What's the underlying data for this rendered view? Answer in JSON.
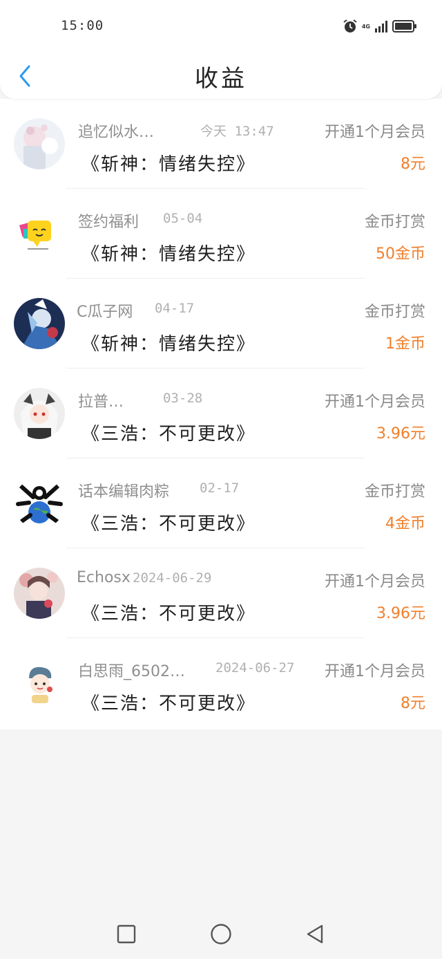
{
  "status_bar": {
    "time": "15:00",
    "network": "4G"
  },
  "header": {
    "title": "收益"
  },
  "items": [
    {
      "name": "追忆似水…",
      "time": "今天 13:47",
      "type": "开通1个月会员",
      "book": "《斩神：情绪失控》",
      "amount": "8元"
    },
    {
      "name": "签约福利",
      "time": "05-04",
      "type": "金币打赏",
      "book": "《斩神：情绪失控》",
      "amount": "50金币"
    },
    {
      "name": "C瓜子网",
      "time": "04-17",
      "type": "金币打赏",
      "book": "《斩神：情绪失控》",
      "amount": "1金币"
    },
    {
      "name": "拉普…",
      "time": "03-28",
      "type": "开通1个月会员",
      "book": "《三浩：不可更改》",
      "amount": "3.96元"
    },
    {
      "name": "话本编辑肉粽",
      "time": "02-17",
      "type": "金币打赏",
      "book": "《三浩：不可更改》",
      "amount": "4金币"
    },
    {
      "name": "Echosx",
      "time": "2024-06-29",
      "type": "开通1个月会员",
      "book": "《三浩：不可更改》",
      "amount": "3.96元"
    },
    {
      "name": "白思雨_6502…",
      "time": "2024-06-27",
      "type": "开通1个月会员",
      "book": "《三浩：不可更改》",
      "amount": "8元"
    }
  ],
  "colors": {
    "accent": "#2a9bf0",
    "amount": "#f07f2a",
    "secondary_text": "#8f8f8f"
  },
  "navigation": {
    "icons": [
      "recent-apps-icon",
      "home-icon",
      "back-icon"
    ]
  }
}
